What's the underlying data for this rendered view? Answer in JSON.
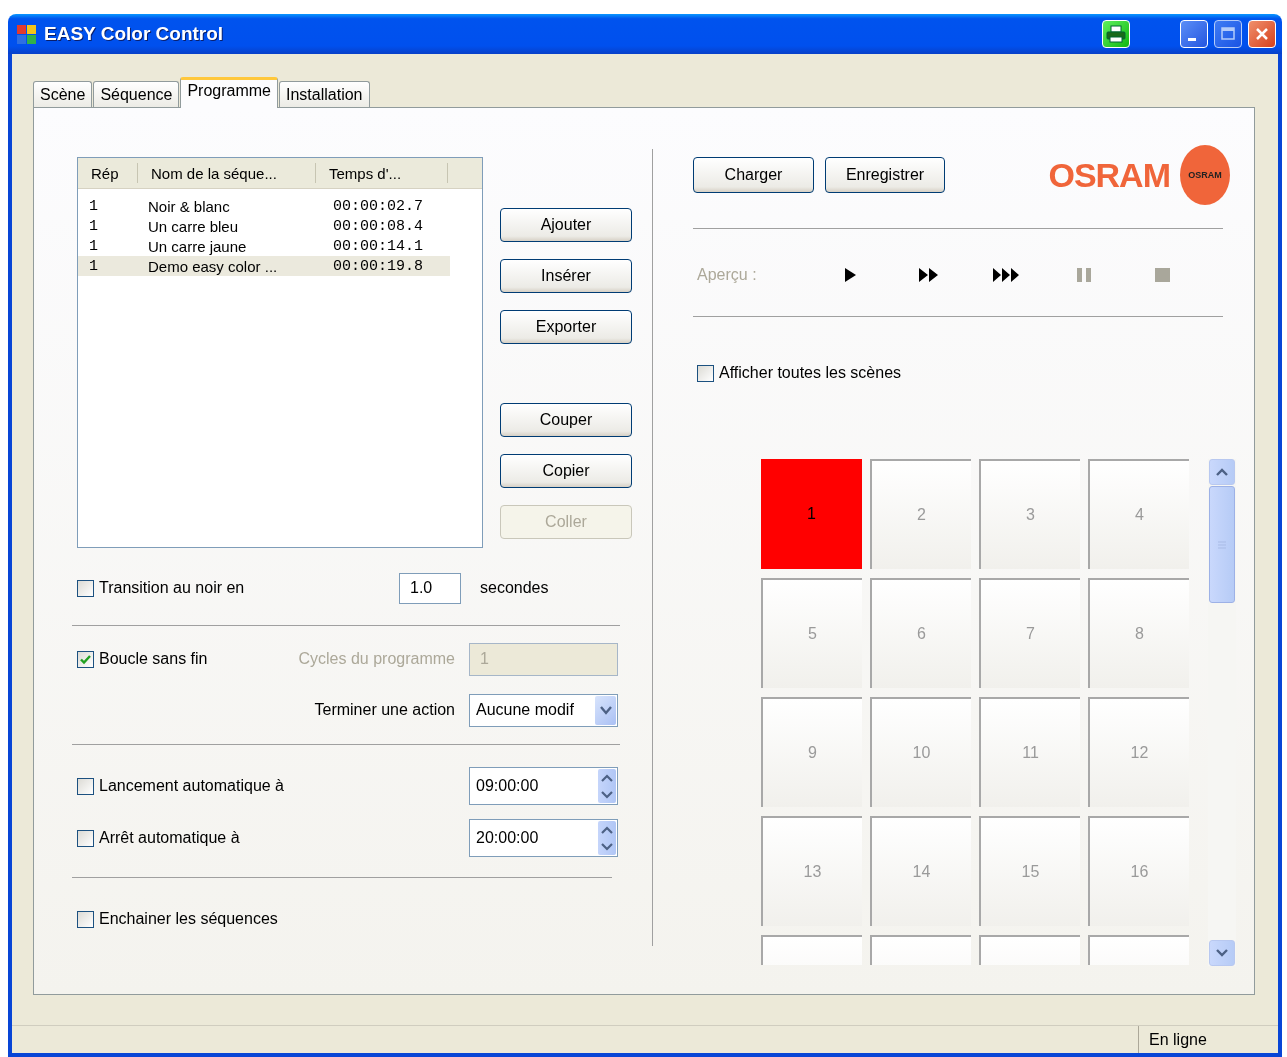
{
  "window": {
    "title": "EASY Color Control"
  },
  "tabs": [
    {
      "label": "Scène",
      "selected": false
    },
    {
      "label": "Séquence",
      "selected": false
    },
    {
      "label": "Programme",
      "selected": true
    },
    {
      "label": "Installation",
      "selected": false
    }
  ],
  "sequence_list": {
    "columns": [
      "Rép",
      "Nom de la séque...",
      "Temps d'..."
    ],
    "rows": [
      {
        "cells": [
          "1",
          "Noir & blanc",
          "00:00:02.7"
        ],
        "selected": false
      },
      {
        "cells": [
          "1",
          "Un carre bleu",
          "00:00:08.4"
        ],
        "selected": false
      },
      {
        "cells": [
          "1",
          "Un carre jaune",
          "00:00:14.1"
        ],
        "selected": false
      },
      {
        "cells": [
          "1",
          "Demo easy color ...",
          "00:00:19.8"
        ],
        "selected": true
      }
    ]
  },
  "list_buttons": [
    {
      "label": "Ajouter",
      "disabled": false
    },
    {
      "label": "Insérer",
      "disabled": false
    },
    {
      "label": "Exporter",
      "disabled": false
    }
  ],
  "edit_buttons": [
    {
      "label": "Couper",
      "disabled": false
    },
    {
      "label": "Copier",
      "disabled": false
    },
    {
      "label": "Coller",
      "disabled": true
    }
  ],
  "transition": {
    "label": "Transition au noir en",
    "checked": false,
    "value": "1.0",
    "unit": "secondes"
  },
  "loop": {
    "label": "Boucle sans fin",
    "checked": true
  },
  "cycles": {
    "label": "Cycles du programme",
    "value": "1",
    "disabled": true
  },
  "end_action": {
    "label": "Terminer une action",
    "value": "Aucune modif"
  },
  "auto_start": {
    "label": "Lancement automatique à",
    "checked": false,
    "value": "09:00:00"
  },
  "auto_stop": {
    "label": "Arrêt automatique à",
    "checked": false,
    "value": "20:00:00"
  },
  "chain": {
    "label": "Enchainer les séquences",
    "checked": false
  },
  "file_buttons": [
    {
      "label": "Charger"
    },
    {
      "label": "Enregistrer"
    }
  ],
  "logo": {
    "wordmark": "OSRAM",
    "bulb_text": "OSRAM"
  },
  "preview": {
    "label": "Aperçu :",
    "controls": [
      {
        "kind": "play",
        "disabled": false
      },
      {
        "kind": "fast",
        "disabled": false
      },
      {
        "kind": "faster",
        "disabled": false
      },
      {
        "kind": "pause",
        "disabled": true
      },
      {
        "kind": "stop",
        "disabled": true
      }
    ]
  },
  "show_all": {
    "label": "Afficher toutes les scènes",
    "checked": false
  },
  "scenes": [
    {
      "label": "1",
      "color": "#ff0000"
    },
    {
      "label": "2"
    },
    {
      "label": "3"
    },
    {
      "label": "4"
    },
    {
      "label": "5"
    },
    {
      "label": "6"
    },
    {
      "label": "7"
    },
    {
      "label": "8"
    },
    {
      "label": "9"
    },
    {
      "label": "10"
    },
    {
      "label": "11"
    },
    {
      "label": "12"
    },
    {
      "label": "13"
    },
    {
      "label": "14"
    },
    {
      "label": "15"
    },
    {
      "label": "16"
    }
  ],
  "status_bar": {
    "state": "En ligne"
  }
}
